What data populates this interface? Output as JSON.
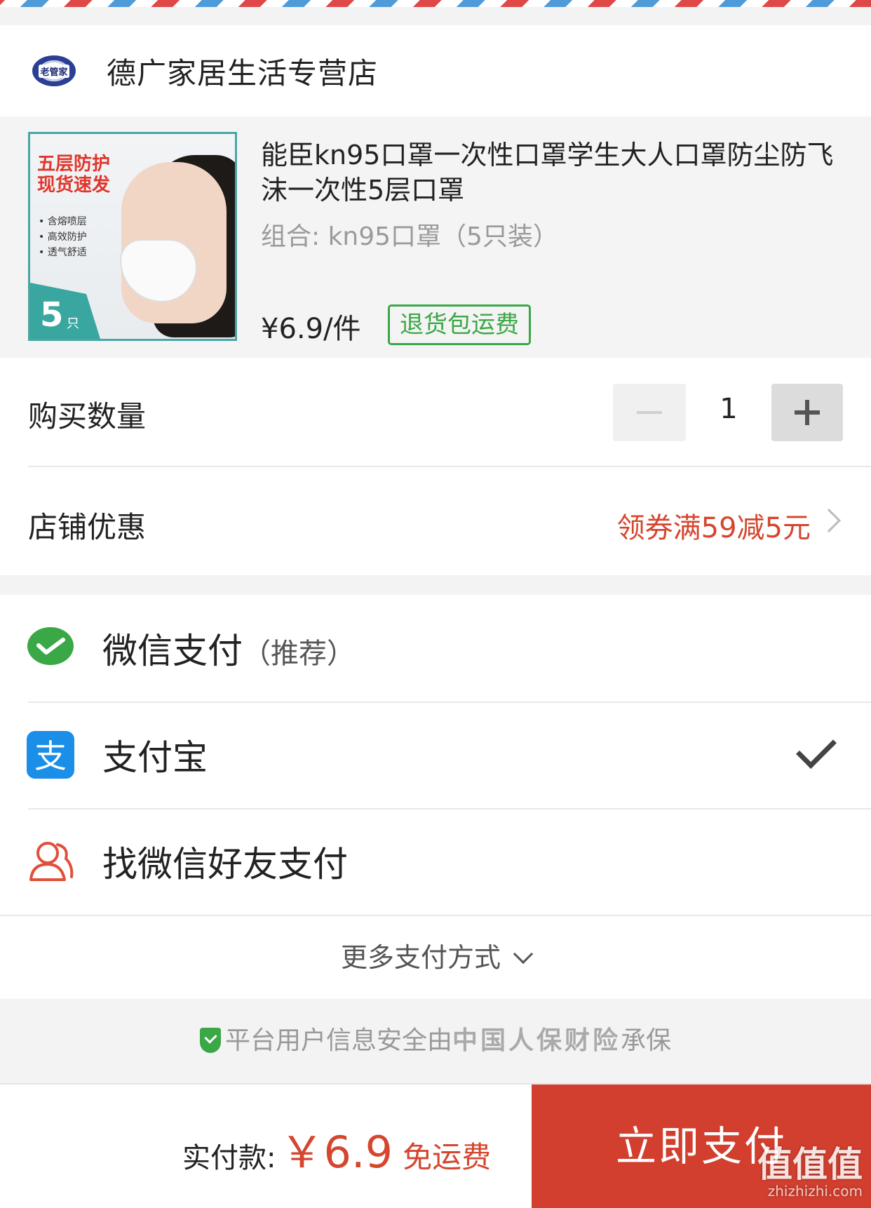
{
  "store": {
    "name": "德广家居生活专营店",
    "logo_text": "老管家"
  },
  "product": {
    "title": "能臣kn95口罩一次性口罩学生大人口罩防尘防飞沫一次性5层口罩",
    "combo": "组合: kn95口罩（5只装）",
    "price": "¥6.9/件",
    "return_tag": "退货包运费",
    "image": {
      "headline_1": "五层防护",
      "headline_2": "现货速发",
      "bullets": [
        "含熔喷层",
        "高效防护",
        "透气舒适"
      ],
      "count": "5",
      "count_unit": "只"
    }
  },
  "quantity": {
    "label": "购买数量",
    "value": "1"
  },
  "coupon": {
    "label": "店铺优惠",
    "value": "领券满59减5元"
  },
  "payment": {
    "methods": [
      {
        "label": "微信支付",
        "sub": "（推荐）",
        "icon": "wechat-pay-icon",
        "selected": false,
        "color": "#3aa846"
      },
      {
        "label": "支付宝",
        "sub": "",
        "icon": "alipay-icon",
        "selected": true,
        "color": "#1b8ee8"
      },
      {
        "label": "找微信好友支付",
        "sub": "",
        "icon": "friends-icon",
        "selected": false,
        "color": "#e0503c"
      }
    ],
    "more": "更多支付方式"
  },
  "insurance": {
    "prefix": "平台用户信息安全由",
    "brand": "中国人保财险",
    "suffix": "承保"
  },
  "footer": {
    "total_label": "实付款:",
    "total_amount": "￥6.9",
    "shipping": "免运费",
    "pay_button": "立即支付"
  },
  "watermark": {
    "logo": "值值值",
    "site": "zhizhizhi.com"
  },
  "colors": {
    "accent_red": "#d23f2f",
    "price_red": "#d5462e",
    "green": "#3aa846"
  }
}
